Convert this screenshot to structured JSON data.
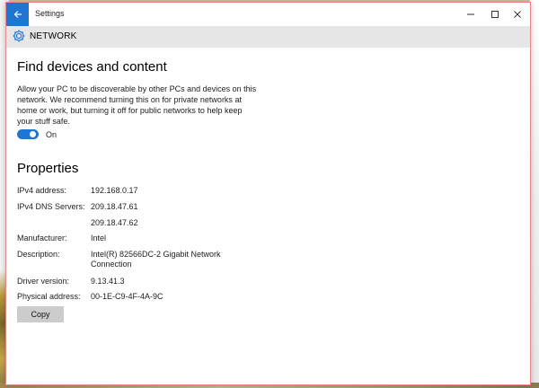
{
  "window": {
    "title": "Settings",
    "section": "NETWORK"
  },
  "discovery": {
    "heading": "Find devices and content",
    "description": "Allow your PC to be discoverable by other PCs and devices on this network. We recommend turning this on for private networks at home or work, but turning it off for public networks to help keep your stuff safe.",
    "toggle_state": "On",
    "toggle_on": true
  },
  "properties": {
    "heading": "Properties",
    "rows": [
      {
        "label": "IPv4 address:",
        "value": "192.168.0.17"
      },
      {
        "label": "IPv4 DNS Servers:",
        "value": "209.18.47.61"
      },
      {
        "label": "",
        "value": "209.18.47.62"
      },
      {
        "label": "Manufacturer:",
        "value": "Intel"
      },
      {
        "label": "Description:",
        "value": "Intel(R) 82566DC-2 Gigabit Network Connection"
      },
      {
        "label": "Driver version:",
        "value": "9.13.41.3"
      },
      {
        "label": "Physical address:",
        "value": "00-1E-C9-4F-4A-9C"
      }
    ],
    "copy_label": "Copy"
  },
  "colors": {
    "accent": "#1f76d2",
    "header_band": "#e6e6e6",
    "button_bg": "#cccccc"
  }
}
